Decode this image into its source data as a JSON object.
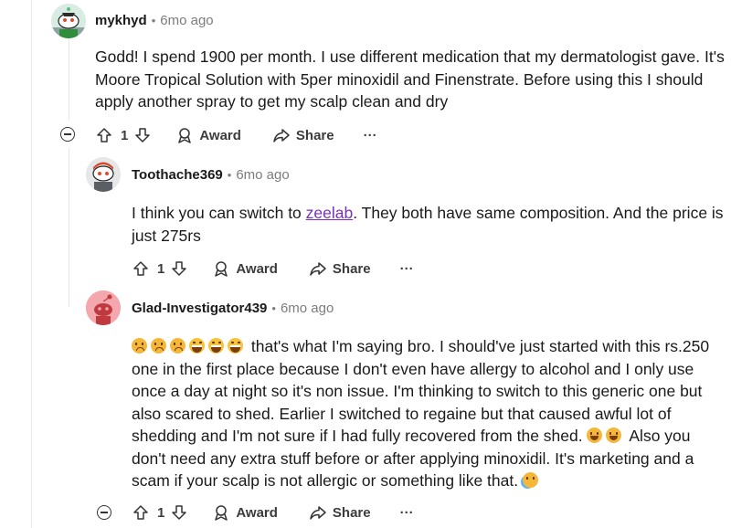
{
  "comments": [
    {
      "username": "mykhyd",
      "separator": "•",
      "time": "6mo ago",
      "body": "Godd! I spend 1900 per month. I use different medication that my dermatologist gave. It's Moore Tropical Solution with 5per minoxidil and Finenstrate. Before using this I should apply another spray to get my scalp clean and dry",
      "votes": "1",
      "award_label": "Award",
      "share_label": "Share",
      "more_label": "···"
    },
    {
      "username": "Toothache369",
      "separator": "•",
      "time": "6mo ago",
      "body_before_link": "I think you can switch to ",
      "link_text": "zeelab",
      "body_after_link": ". They both have same composition. And the price is just 275rs",
      "votes": "1",
      "award_label": "Award",
      "share_label": "Share",
      "more_label": "···"
    },
    {
      "username": "Glad-Investigator439",
      "separator": "•",
      "time": "6mo ago",
      "body_part1": " that's what I'm saying bro. I should've just started with this rs.250 one in the first place because I don't even have allergy to alcohol and I only use once a day at night so it's non issue. I'm thinking to switch to this generic one but also scared to shed. Earlier I switched to regaine but that caused awful lot of shedding and I'm not sure if I had fully recovered from the shed. ",
      "body_part2": " Also you don't need any extra stuff before or after applying minoxidil. It's marketing and a scam if your scalp is not allergic or something like that. ",
      "votes": "1",
      "award_label": "Award",
      "share_label": "Share",
      "more_label": "···"
    }
  ],
  "icons": {
    "upvote": "upvote-arrow-icon",
    "downvote": "downvote-arrow-icon",
    "award": "award-ribbon-icon",
    "share": "share-arrow-icon",
    "collapse": "collapse-minus-icon",
    "emoji": "emoji-icon"
  },
  "colors": {
    "link": "#7b2fbe",
    "meta": "#7c7c7c",
    "thread_line": "#e5e7e9"
  }
}
